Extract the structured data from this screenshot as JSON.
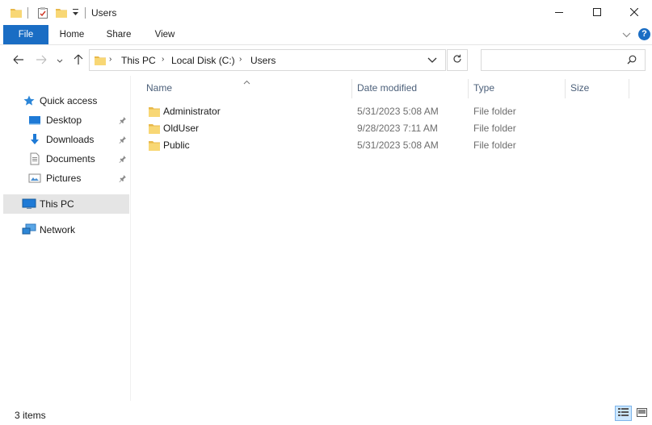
{
  "window": {
    "title": "Users",
    "controls": {
      "minimize": "minimize-icon",
      "maximize": "maximize-icon",
      "close": "close-icon"
    }
  },
  "ribbon": {
    "tabs": [
      {
        "label": "File",
        "active": true
      },
      {
        "label": "Home"
      },
      {
        "label": "Share"
      },
      {
        "label": "View"
      }
    ],
    "help_label": "?",
    "accent": "#1a6dc4"
  },
  "address": {
    "breadcrumbs": [
      "This PC",
      "Local Disk (C:)",
      "Users"
    ],
    "separator": "›"
  },
  "search": {
    "value": "",
    "placeholder": ""
  },
  "sidebar": {
    "items": [
      {
        "label": "Quick access",
        "icon": "star-icon"
      },
      {
        "label": "Desktop",
        "icon": "desktop-icon",
        "pinned": true
      },
      {
        "label": "Downloads",
        "icon": "download-icon",
        "pinned": true
      },
      {
        "label": "Documents",
        "icon": "documents-icon",
        "pinned": true
      },
      {
        "label": "Pictures",
        "icon": "pictures-icon",
        "pinned": true
      },
      {
        "label": "This PC",
        "icon": "computer-icon",
        "selected": true
      },
      {
        "label": "Network",
        "icon": "network-icon"
      }
    ]
  },
  "columns": [
    "Name",
    "Date modified",
    "Type",
    "Size"
  ],
  "files": [
    {
      "name": "Administrator",
      "date": "5/31/2023 5:08 AM",
      "type": "File folder"
    },
    {
      "name": "OldUser",
      "date": "9/28/2023 7:11 AM",
      "type": "File folder"
    },
    {
      "name": "Public",
      "date": "5/31/2023 5:08 AM",
      "type": "File folder"
    }
  ],
  "status": {
    "item_count": "3 items"
  },
  "colors": {
    "folder": "#f8d775",
    "folder_dark": "#e8b84a",
    "selection": "#e5e5e5",
    "column_header": "#4c607a"
  }
}
